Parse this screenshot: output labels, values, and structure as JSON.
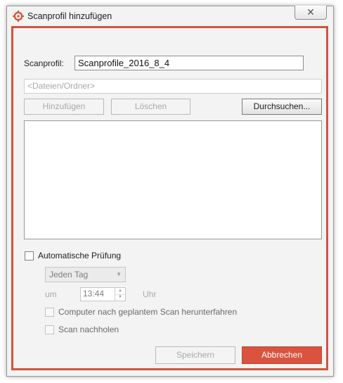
{
  "window": {
    "title": "Scanprofil hinzufügen",
    "close_icon": "close-icon",
    "app_icon": "scan-target-icon"
  },
  "form": {
    "profile_label": "Scanprofil:",
    "profile_value": "Scanprofile_2016_8_4",
    "path_placeholder": "<Dateien/Ordner>",
    "add_button": "Hinzufügen",
    "delete_button": "Löschen",
    "browse_button": "Durchsuchen...",
    "file_list": []
  },
  "schedule": {
    "auto_check_label": "Automatische Prüfung",
    "auto_check_checked": false,
    "frequency_value": "Jeden Tag",
    "at_label": "um",
    "time_value": "13:44",
    "clock_label": "Uhr",
    "shutdown_label": "Computer nach geplantem Scan herunterfahren",
    "shutdown_checked": false,
    "catchup_label": "Scan nachholen",
    "catchup_checked": false
  },
  "footer": {
    "save_button": "Speichern",
    "cancel_button": "Abbrechen"
  },
  "colors": {
    "accent": "#d9533f",
    "frame": "#d1533f"
  }
}
